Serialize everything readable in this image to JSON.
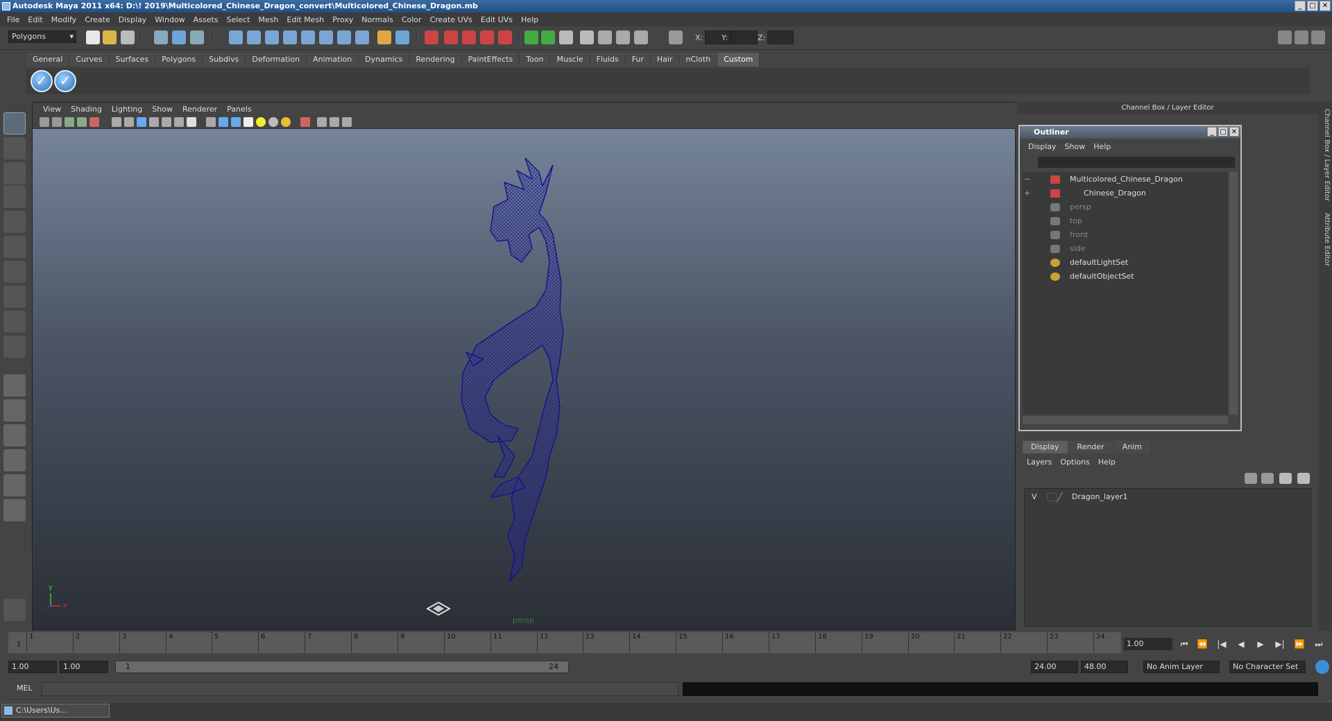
{
  "window": {
    "title": "Autodesk Maya 2011 x64: D:\\! 2019\\Multicolored_Chinese_Dragon_convert\\Multicolored_Chinese_Dragon.mb",
    "buttons": [
      "_",
      "□",
      "✕"
    ]
  },
  "menubar": [
    "File",
    "Edit",
    "Modify",
    "Create",
    "Display",
    "Window",
    "Assets",
    "Select",
    "Mesh",
    "Edit Mesh",
    "Proxy",
    "Normals",
    "Color",
    "Create UVs",
    "Edit UVs",
    "Help"
  ],
  "statusline": {
    "mode": "Polygons",
    "x_label": "X:",
    "y_label": "Y:",
    "z_label": "Z:"
  },
  "shelf": {
    "tabs": [
      "General",
      "Curves",
      "Surfaces",
      "Polygons",
      "Subdivs",
      "Deformation",
      "Animation",
      "Dynamics",
      "Rendering",
      "PaintEffects",
      "Toon",
      "Muscle",
      "Fluids",
      "Fur",
      "Hair",
      "nCloth",
      "Custom"
    ],
    "active_tab": "Custom",
    "buttons": [
      "✓",
      "✓"
    ]
  },
  "viewport": {
    "menu": [
      "View",
      "Shading",
      "Lighting",
      "Show",
      "Renderer",
      "Panels"
    ],
    "camera_label": "persp",
    "axis_y": "y",
    "axis_x": "x",
    "wire_color": "#1a1a8a"
  },
  "channel_box": {
    "header": "Channel Box / Layer Editor",
    "side_tabs": [
      "Channel Box / Layer Editor",
      "Attribute Editor"
    ]
  },
  "outliner": {
    "title": "Outliner",
    "menu": [
      "Display",
      "Show",
      "Help"
    ],
    "items": [
      {
        "label": "Multicolored_Chinese_Dragon",
        "expander": "−",
        "dim": false
      },
      {
        "label": "Chinese_Dragon",
        "expander": "+",
        "dim": false
      },
      {
        "label": "persp",
        "expander": "",
        "dim": true
      },
      {
        "label": "top",
        "expander": "",
        "dim": true
      },
      {
        "label": "front",
        "expander": "",
        "dim": true
      },
      {
        "label": "side",
        "expander": "",
        "dim": true
      },
      {
        "label": "defaultLightSet",
        "expander": "",
        "dim": false
      },
      {
        "label": "defaultObjectSet",
        "expander": "",
        "dim": false
      }
    ]
  },
  "layer_editor": {
    "tabs": [
      "Display",
      "Render",
      "Anim"
    ],
    "active_tab": "Display",
    "menu": [
      "Layers",
      "Options",
      "Help"
    ],
    "layers": [
      {
        "visible": "V",
        "name": "Dragon_layer1"
      }
    ]
  },
  "timeline": {
    "ticks": [
      "1",
      "2",
      "3",
      "4",
      "5",
      "6",
      "7",
      "8",
      "9",
      "10",
      "11",
      "12",
      "13",
      "14",
      "15",
      "16",
      "17",
      "18",
      "19",
      "20",
      "21",
      "22",
      "23",
      "24"
    ],
    "current_marker": "1",
    "current_frame": "1.00",
    "playback": [
      "⏮",
      "⏪",
      "|◀",
      "◀",
      "▶",
      "▶|",
      "⏩",
      "⏭"
    ]
  },
  "range": {
    "start": "1.00",
    "playback_start": "1.00",
    "slider_start": "1",
    "slider_end": "24",
    "playback_end": "24.00",
    "end": "48.00",
    "anim_layer": "No Anim Layer",
    "character_set": "No Character Set"
  },
  "command_line": {
    "label": "MEL"
  },
  "taskbar": {
    "item": "C:\\Users\\Us..."
  }
}
